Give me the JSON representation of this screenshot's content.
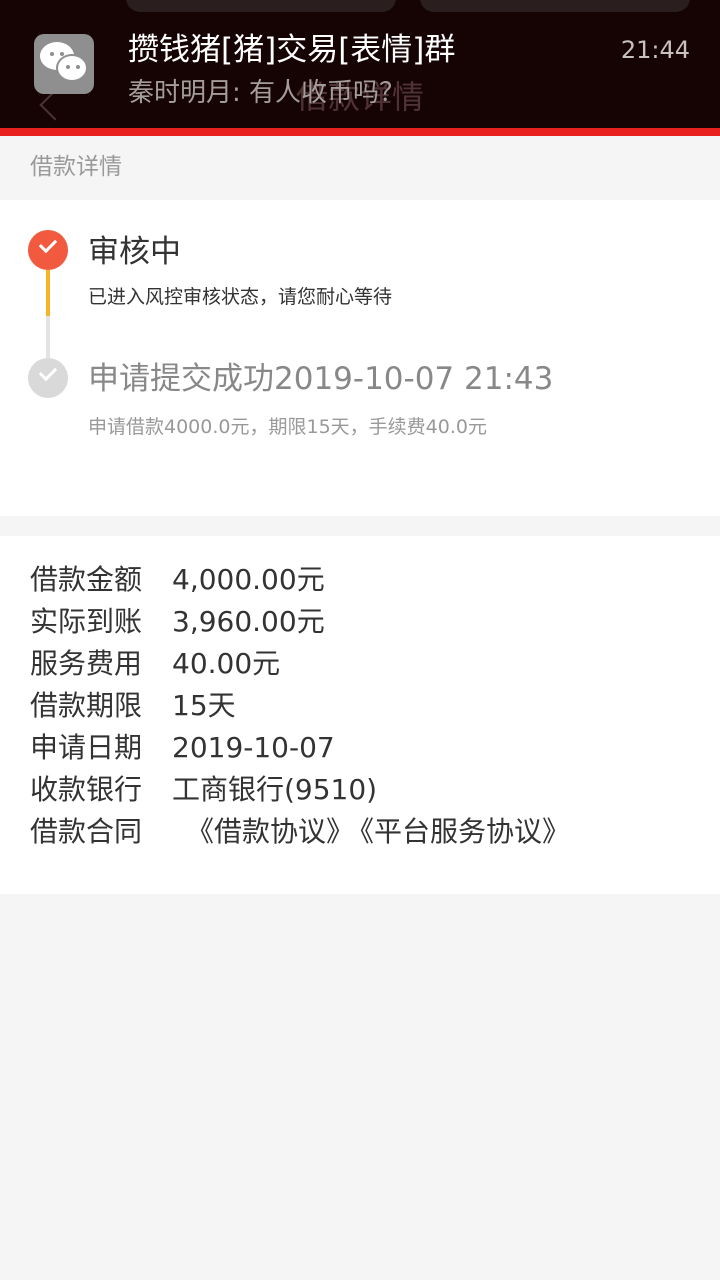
{
  "notification": {
    "title": "攒钱猪[猪]交易[表情]群",
    "message": "秦时明月: 有人收币吗？",
    "time": "21:44",
    "app_icon": "wechat-icon",
    "underlying_page_title": "借款详情"
  },
  "section_header": "借款详情",
  "timeline": {
    "steps": [
      {
        "title": "审核中",
        "desc": "已进入风控审核状态，请您耐心等待"
      },
      {
        "title": "申请提交成功2019-10-07 21:43",
        "desc": "申请借款4000.0元，期限15天，手续费40.0元"
      }
    ]
  },
  "details": [
    {
      "label": "借款金额",
      "value": "4,000.00元"
    },
    {
      "label": "实际到账",
      "value": "3,960.00元"
    },
    {
      "label": "服务费用",
      "value": "40.00元"
    },
    {
      "label": "借款期限",
      "value": "15天"
    },
    {
      "label": "申请日期",
      "value": "2019-10-07"
    },
    {
      "label": "收款银行",
      "value": "工商银行(9510)"
    }
  ],
  "contract": {
    "label": "借款合同",
    "link1": "《借款协议》",
    "link2": "《平台服务协议》"
  },
  "colors": {
    "accent_red": "#e8211e",
    "step_active": "#f15a3f",
    "line_active": "#f5b528"
  }
}
